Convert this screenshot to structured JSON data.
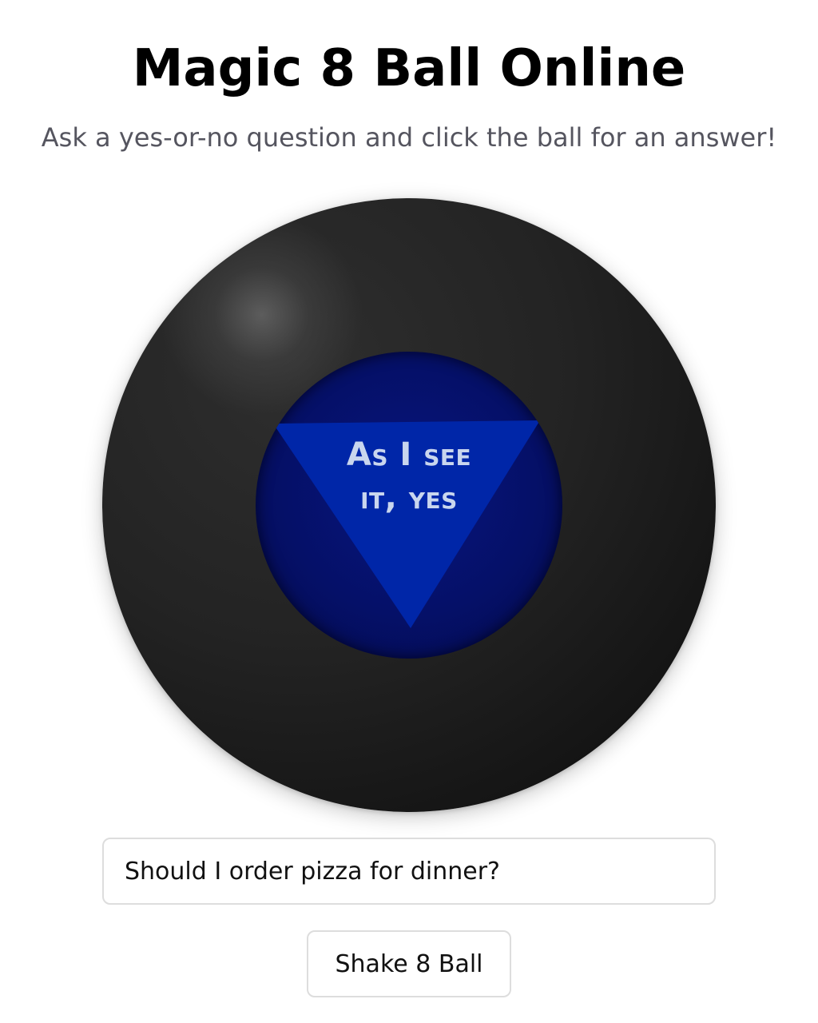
{
  "page": {
    "title": "Magic 8 Ball Online",
    "subtitle": "Ask a yes-or-no question and click the ball for an answer!"
  },
  "ball": {
    "answer_line1": "As I see",
    "answer_line2": "it, yes",
    "colors": {
      "ball": "#1e1e1e",
      "window": "#051068",
      "triangle": "#0026a8",
      "answer_text": "#c9d6ee"
    }
  },
  "question": {
    "value": "Should I order pizza for dinner?",
    "placeholder": ""
  },
  "actions": {
    "shake_label": "Shake 8 Ball"
  }
}
